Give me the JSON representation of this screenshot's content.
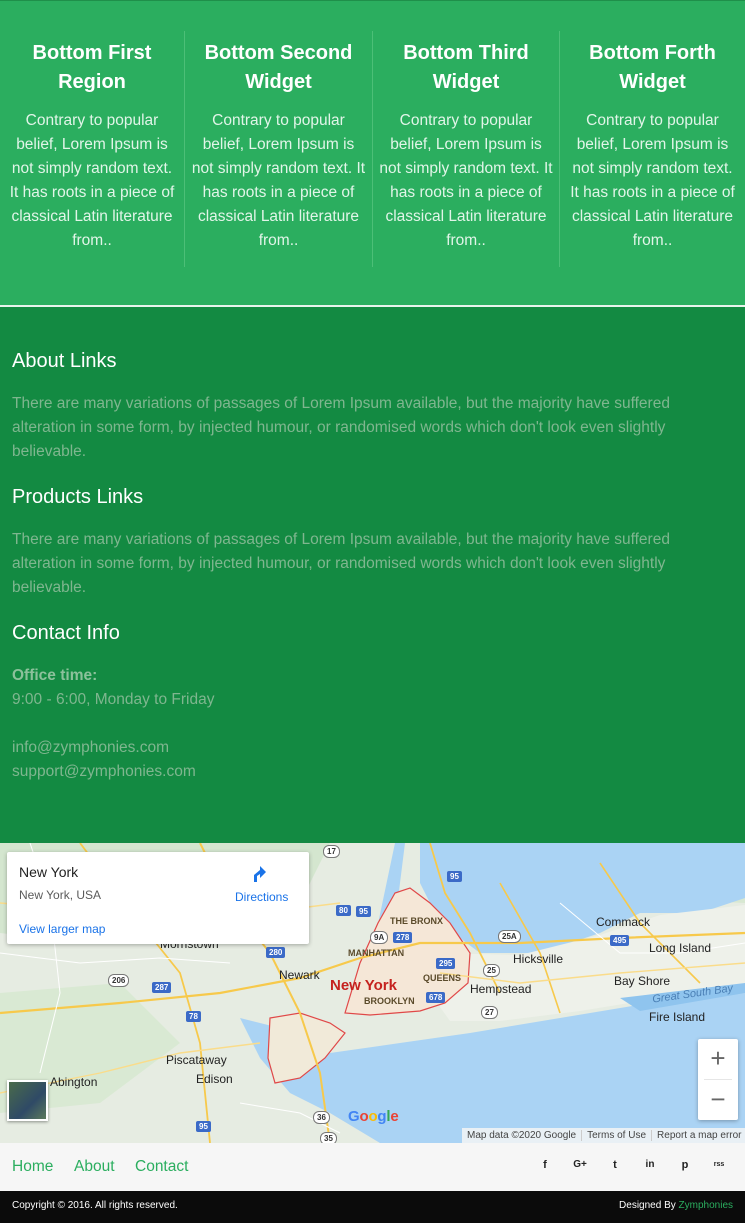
{
  "widgets": [
    {
      "title": "Bottom First Region",
      "body": "Contrary to popular belief, Lorem Ipsum is not simply random text. It has roots in a piece of classical Latin literature from.."
    },
    {
      "title": "Bottom Second Widget",
      "body": "Contrary to popular belief, Lorem Ipsum is not simply random text. It has roots in a piece of classical Latin literature from.."
    },
    {
      "title": "Bottom Third Widget",
      "body": "Contrary to popular belief, Lorem Ipsum is not simply random text. It has roots in a piece of classical Latin literature from.."
    },
    {
      "title": "Bottom Forth Widget",
      "body": "Contrary to popular belief, Lorem Ipsum is not simply random text. It has roots in a piece of classical Latin literature from.."
    }
  ],
  "about": {
    "heading": "About Links",
    "text": "There are many variations of passages of Lorem Ipsum available, but the majority have suffered alteration in some form, by injected humour, or randomised words which don't look even slightly believable."
  },
  "products": {
    "heading": "Products Links",
    "text": "There are many variations of passages of Lorem Ipsum available, but the majority have suffered alteration in some form, by injected humour, or randomised words which don't look even slightly believable."
  },
  "contact": {
    "heading": "Contact Info",
    "office_label": "Office time:",
    "office_hours": "9:00 - 6:00, Monday to Friday",
    "email_info": "info@zymphonies.com",
    "email_support": "support@zymphonies.com"
  },
  "map": {
    "place_name": "New York",
    "place_address": "New York, USA",
    "directions_label": "Directions",
    "larger_map_link": "View larger map",
    "zoom_in": "+",
    "zoom_out": "−",
    "google_logo": [
      "G",
      "o",
      "o",
      "g",
      "l",
      "e"
    ],
    "google_colors": [
      "#4285f4",
      "#ea4335",
      "#fbbc05",
      "#4285f4",
      "#34a853",
      "#ea4335"
    ],
    "attribution": "Map data ©2020 Google",
    "terms": "Terms of Use",
    "report": "Report a map error",
    "labels": {
      "new_york": "New York",
      "the_bronx": "THE BRONX",
      "manhattan": "MANHATTAN",
      "queens": "QUEENS",
      "brooklyn": "BROOKLYN",
      "newark": "Newark",
      "hicksville": "Hicksville",
      "hempstead": "Hempstead",
      "commack": "Commack",
      "long_island": "Long Island",
      "bay_shore": "Bay Shore",
      "great_south_bay": "Great South Bay",
      "fire_island": "Fire Island",
      "piscataway": "Piscataway",
      "edison": "Edison",
      "morristown": "Morristown",
      "abington": "Abington"
    },
    "shields": {
      "i95": "95",
      "i80": "80",
      "i95b": "95",
      "i278": "278",
      "i295": "295",
      "i678": "678",
      "i495": "495",
      "r9a": "9A",
      "r25a": "25A",
      "r25": "25",
      "r27": "27",
      "r17": "17",
      "r206": "206",
      "i287": "287",
      "i280": "280",
      "i78": "78",
      "i95c": "95",
      "r36": "36",
      "r35": "35"
    }
  },
  "footer_nav": {
    "home": "Home",
    "about": "About",
    "contact": "Contact",
    "social_icons": [
      "facebook-icon",
      "google-plus-icon",
      "twitter-icon",
      "linkedin-icon",
      "pinterest-icon",
      "rss-icon"
    ],
    "social_glyphs": [
      "f",
      "G+",
      "t",
      "in",
      "p",
      "rss"
    ]
  },
  "copyright": {
    "text": "Copyright © 2016. All rights reserved.",
    "designed_by": "Designed By",
    "brand": "Zymphonies"
  },
  "colors": {
    "widgets_bg": "#2bae5f",
    "info_bg": "#138a42",
    "accent": "#2bae5f",
    "copyright_bg": "#0b0b0b"
  }
}
